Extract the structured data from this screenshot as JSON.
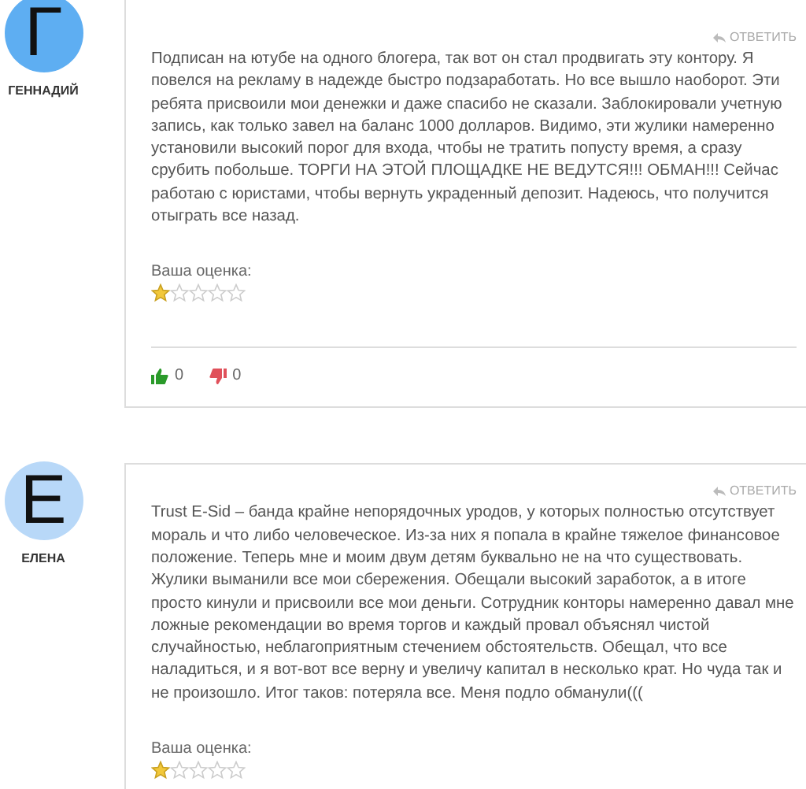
{
  "comments": [
    {
      "author": "ГЕННАДИЙ",
      "initial": "Г",
      "color": "#5eaef2",
      "reply": "ОТВЕТИТЬ",
      "text": "Подписан на ютубе на одного блогера, так вот он стал продвигать эту контору. Я повелся на рекламу в надежде быстро подзаработать. Но все вышло наоборот. Эти ребята присвоили мои денежки и даже спасибо не сказали. Заблокировали учетную запись, как только завел на баланс 1000 долларов. Видимо, эти жулики намеренно установили высокий порог для входа, чтобы не тратить попусту время, а сразу срубить побольше. ТОРГИ НА ЭТОЙ ПЛОЩАДКЕ НЕ ВЕДУТСЯ!!! ОБМАН!!! Сейчас работаю с юристами, чтобы вернуть украденный депозит. Надеюсь, что получится отыграть все назад.",
      "rating_label": "Ваша оценка:",
      "stars": 1,
      "likes": "0",
      "dislikes": "0"
    },
    {
      "author": "ЕЛЕНА",
      "initial": "Е",
      "color": "#b8d8f8",
      "reply": "ОТВЕТИТЬ",
      "text": "Trust E-Sid – банда крайне непорядочных уродов, у которых полностью отсутствует мораль и что либо человеческое. Из-за них я попала в крайне тяжелое финансовое положение. Теперь мне и моим двум детям буквально не на что существовать. Жулики выманили все мои сбережения. Обещали высокий заработок, а в итоге просто кинули и присвоили все мои деньги. Сотрудник конторы намеренно давал мне ложные рекомендации во время торгов и каждый провал объяснял чистой случайностью, неблагоприятным стечением обстоятельств. Обещал, что все наладиться, и я вот-вот все верну и увеличу капитал в несколько крат. Но чуда так и не произошло. Итог таков: потеряла все. Меня подло обманули(((",
      "rating_label": "Ваша оценка:",
      "stars": 1
    }
  ]
}
